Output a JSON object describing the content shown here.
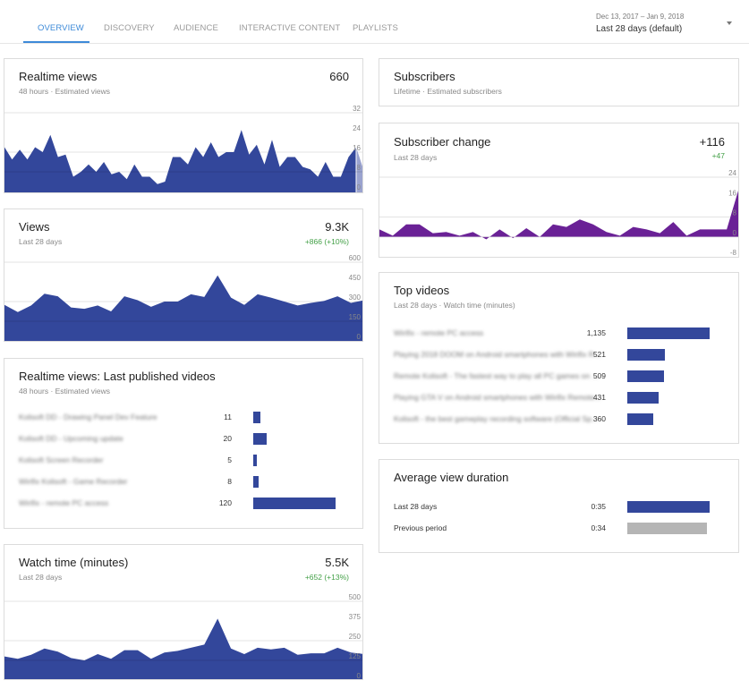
{
  "tabs": [
    {
      "label": "OVERVIEW",
      "active": true
    },
    {
      "label": "DISCOVERY",
      "active": false
    },
    {
      "label": "AUDIENCE",
      "active": false
    },
    {
      "label": "INTERACTIVE CONTENT",
      "active": false
    },
    {
      "label": "PLAYLISTS",
      "active": false
    }
  ],
  "date_picker": {
    "range": "Dec 13, 2017 – Jan 9, 2018",
    "label": "Last 28 days (default)",
    "icon": "dropdown-arrow-icon"
  },
  "colors": {
    "primary_series": "#33479b",
    "subscriber_series": "#6a2196",
    "active_tab": "#3d8ad8",
    "positive_delta": "#43a047",
    "previous_period_bar": "#b5b5b5"
  },
  "cards": {
    "realtime_views": {
      "title": "Realtime views",
      "subtitle": "48 hours · Estimated views",
      "value": "660"
    },
    "views": {
      "title": "Views",
      "subtitle": "Last 28 days",
      "value": "9.3K",
      "delta": "+866 (+10%)"
    },
    "realtime_last_published": {
      "title": "Realtime views: Last published videos",
      "subtitle": "48 hours · Estimated views",
      "items": [
        {
          "name": "Kolisoft DD - Drawing Panel Dev Feature",
          "value": "11",
          "amount": 11
        },
        {
          "name": "Kolisoft DD - Upcoming update",
          "value": "20",
          "amount": 20
        },
        {
          "name": "Kolisoft Screen Recorder",
          "value": "5",
          "amount": 5
        },
        {
          "name": "Wirifix Kolisoft - Game Recorder",
          "value": "8",
          "amount": 8
        },
        {
          "name": "Wirifix - remote PC access",
          "value": "120",
          "amount": 120
        }
      ],
      "max": 120
    },
    "watch_time": {
      "title": "Watch time (minutes)",
      "subtitle": "Last 28 days",
      "value": "5.5K",
      "delta": "+652 (+13%)"
    },
    "subscribers": {
      "title": "Subscribers",
      "subtitle": "Lifetime · Estimated subscribers"
    },
    "subscriber_change": {
      "title": "Subscriber change",
      "subtitle": "Last 28 days",
      "value": "+116",
      "delta": "+47"
    },
    "top_videos": {
      "title": "Top videos",
      "subtitle": "Last 28 days · Watch time (minutes)",
      "items": [
        {
          "name": "Wirifix - remote PC access",
          "value": "1,135",
          "amount": 1135
        },
        {
          "name": "Playing 2018 DOOM on Android smartphones with Wirifix R...",
          "value": "521",
          "amount": 521
        },
        {
          "name": "Remote Kolisoft - The fastest way to play all PC games on ...",
          "value": "509",
          "amount": 509
        },
        {
          "name": "Playing GTA V on Android smartphones with Wirifix Remote...",
          "value": "431",
          "amount": 431
        },
        {
          "name": "Kolisoft - the best gameplay recording software (Official Sp...",
          "value": "360",
          "amount": 360
        }
      ],
      "max": 1135
    },
    "avg_view_duration": {
      "title": "Average view duration",
      "items": [
        {
          "name": "Last 28 days",
          "value": "0:35",
          "seconds": 35
        },
        {
          "name": "Previous period",
          "value": "0:34",
          "seconds": 34
        }
      ],
      "max": 35
    }
  },
  "chart_data": [
    {
      "id": "realtime_views",
      "type": "area",
      "title": "Realtime views",
      "xlabel": "48 hours",
      "ylabel": "Estimated views",
      "ylim": [
        0,
        32
      ],
      "yticks": [
        0,
        8,
        16,
        24,
        32
      ],
      "grid": true,
      "values": [
        18,
        13,
        17,
        13,
        18,
        16,
        23,
        14,
        15,
        6,
        8,
        11,
        8,
        12,
        7,
        8,
        5,
        11,
        6,
        6,
        3,
        4,
        14,
        14,
        11,
        18,
        14,
        20,
        14,
        16,
        16,
        25,
        15,
        19,
        11,
        21,
        10,
        14,
        14,
        10,
        9,
        6,
        12,
        6,
        6,
        14,
        18
      ],
      "partial_last_value": 8
    },
    {
      "id": "views",
      "type": "area",
      "title": "Views",
      "xlabel": "Last 28 days",
      "ylim": [
        0,
        600
      ],
      "yticks": [
        0,
        150,
        300,
        450,
        600
      ],
      "grid": true,
      "values": [
        275,
        220,
        270,
        360,
        340,
        255,
        245,
        270,
        225,
        340,
        310,
        260,
        300,
        300,
        355,
        335,
        500,
        330,
        275,
        355,
        330,
        300,
        270,
        290,
        305,
        340,
        290,
        310
      ]
    },
    {
      "id": "watch_time",
      "type": "area",
      "title": "Watch time (minutes)",
      "xlabel": "Last 28 days",
      "ylim": [
        0,
        500
      ],
      "yticks": [
        0,
        125,
        250,
        375,
        500
      ],
      "grid": true,
      "values": [
        150,
        135,
        160,
        200,
        180,
        140,
        125,
        165,
        135,
        190,
        190,
        135,
        175,
        185,
        205,
        225,
        390,
        200,
        165,
        205,
        195,
        205,
        160,
        170,
        170,
        205,
        175,
        165
      ]
    },
    {
      "id": "subscriber_change",
      "type": "area",
      "title": "Subscriber change",
      "xlabel": "Last 28 days",
      "ylim": [
        -8,
        24
      ],
      "yticks": [
        -8,
        0,
        8,
        16,
        24
      ],
      "grid": true,
      "values": [
        3,
        0.5,
        5,
        5,
        1.5,
        2,
        0.5,
        2,
        -1,
        3,
        -0.5,
        3.5,
        0,
        5,
        4,
        7,
        5,
        2,
        0.5,
        4,
        3,
        1.5,
        6,
        0.5,
        3,
        3,
        3,
        21
      ]
    }
  ]
}
